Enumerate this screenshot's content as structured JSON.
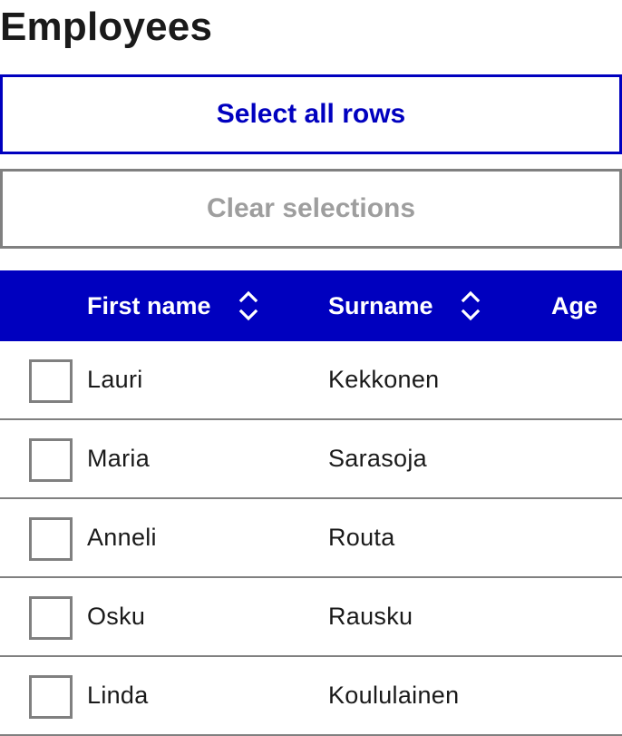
{
  "page": {
    "title": "Employees"
  },
  "actions": {
    "select_all_label": "Select all rows",
    "clear_label": "Clear selections"
  },
  "table": {
    "headers": {
      "first_name": "First name",
      "surname": "Surname",
      "age": "Age"
    },
    "sort_icon": "sort-up-down-icon",
    "rows": [
      {
        "first_name": "Lauri",
        "surname": "Kekkonen",
        "age": "",
        "selected": false
      },
      {
        "first_name": "Maria",
        "surname": "Sarasoja",
        "age": "",
        "selected": false
      },
      {
        "first_name": "Anneli",
        "surname": "Routa",
        "age": "",
        "selected": false
      },
      {
        "first_name": "Osku",
        "surname": "Rausku",
        "age": "",
        "selected": false
      },
      {
        "first_name": "Linda",
        "surname": "Koululainen",
        "age": "",
        "selected": false
      }
    ]
  },
  "colors": {
    "brand": "#0000bf",
    "text": "#1a1a1a",
    "border_gray": "#808080",
    "disabled_text": "#9e9e9e"
  }
}
